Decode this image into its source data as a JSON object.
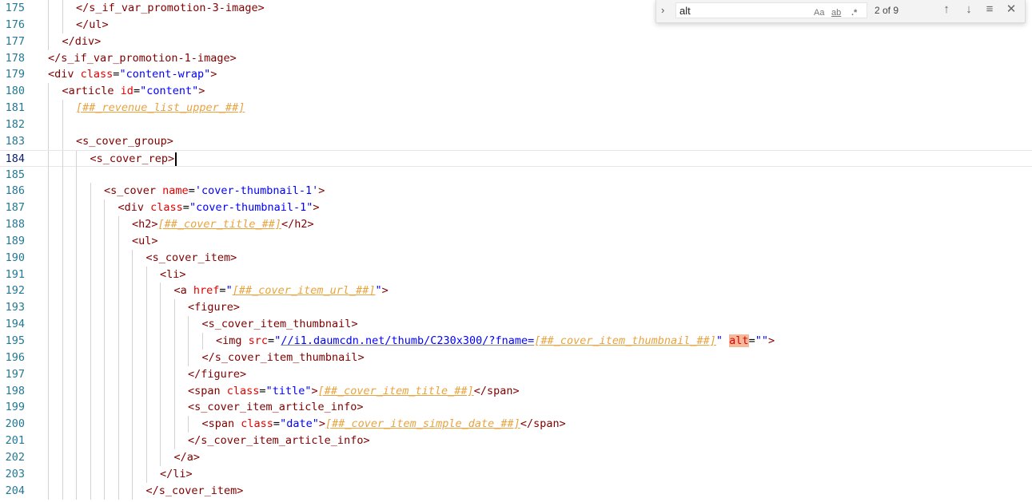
{
  "editor": {
    "current_line": "184",
    "lines": [
      {
        "n": "175",
        "code": "</s_if_var_promotion-3-image>"
      },
      {
        "n": "176",
        "code": "</ul>"
      },
      {
        "n": "177",
        "code": "</div>"
      },
      {
        "n": "178",
        "code": "</s_if_var_promotion-1-image>"
      },
      {
        "n": "179",
        "code": "<div class=\"content-wrap\">"
      },
      {
        "n": "180",
        "code": "<article id=\"content\">"
      },
      {
        "n": "181",
        "code": "[##_revenue_list_upper_##]"
      },
      {
        "n": "182",
        "code": ""
      },
      {
        "n": "183",
        "code": "<s_cover_group>"
      },
      {
        "n": "184",
        "code": "<s_cover_rep>"
      },
      {
        "n": "185",
        "code": ""
      },
      {
        "n": "186",
        "code": "<s_cover name='cover-thumbnail-1'>"
      },
      {
        "n": "187",
        "code": "<div class=\"cover-thumbnail-1\">"
      },
      {
        "n": "188",
        "code": "<h2>[##_cover_title_##]</h2>"
      },
      {
        "n": "189",
        "code": "<ul>"
      },
      {
        "n": "190",
        "code": "<s_cover_item>"
      },
      {
        "n": "191",
        "code": "<li>"
      },
      {
        "n": "192",
        "code": "<a href=\"[##_cover_item_url_##]\">"
      },
      {
        "n": "193",
        "code": "<figure>"
      },
      {
        "n": "194",
        "code": "<s_cover_item_thumbnail>"
      },
      {
        "n": "195",
        "code": "<img src=\"//i1.daumcdn.net/thumb/C230x300/?fname=[##_cover_item_thumbnail_##]\" alt=\"\">"
      },
      {
        "n": "196",
        "code": "</s_cover_item_thumbnail>"
      },
      {
        "n": "197",
        "code": "</figure>"
      },
      {
        "n": "198",
        "code": "<span class=\"title\">[##_cover_item_title_##]</span>"
      },
      {
        "n": "199",
        "code": "<s_cover_item_article_info>"
      },
      {
        "n": "200",
        "code": "<span class=\"date\">[##_cover_item_simple_date_##]</span>"
      },
      {
        "n": "201",
        "code": "</s_cover_item_article_info>"
      },
      {
        "n": "202",
        "code": "</a>"
      },
      {
        "n": "203",
        "code": "</li>"
      },
      {
        "n": "204",
        "code": "</s_cover_item>"
      }
    ]
  },
  "find_widget": {
    "query": "alt",
    "match_case_label": "Aa",
    "whole_word_label": "ab",
    "regex_label": ".*",
    "match_count": "2 of 9",
    "toggle_icon": "chevron-right-icon",
    "prev_icon": "arrow-up-icon",
    "next_icon": "arrow-down-icon",
    "selection_icon": "find-in-selection-icon",
    "close_icon": "close-icon"
  },
  "colors": {
    "tag": "#800000",
    "attribute": "#e50000",
    "string": "#0000ff",
    "variable": "#e8a33d",
    "line_number": "#237893",
    "match_highlight": "#f5b99a"
  }
}
